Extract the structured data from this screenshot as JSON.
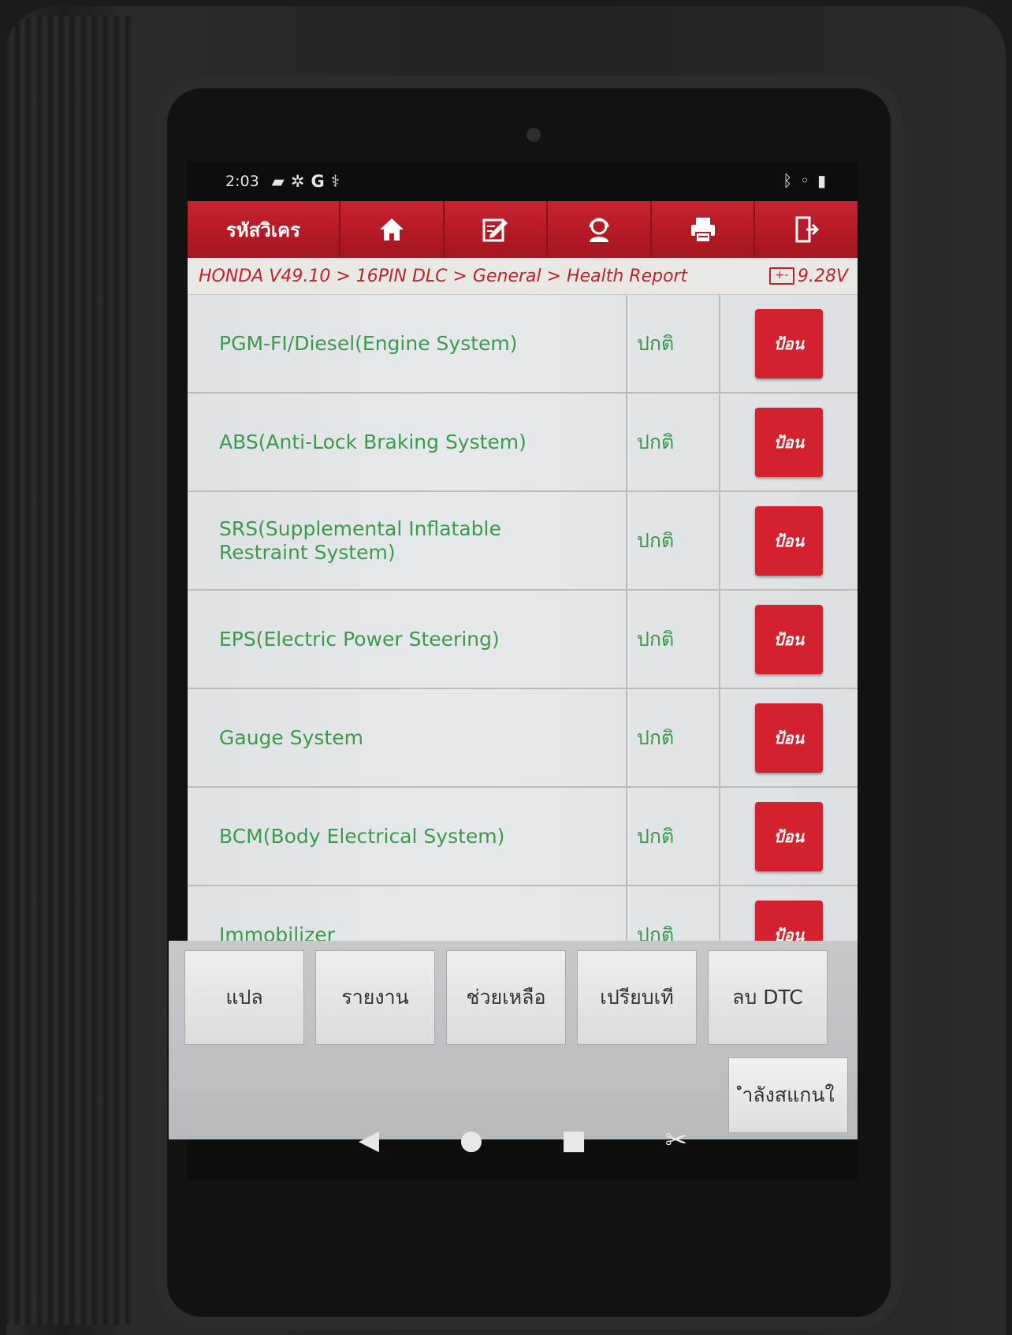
{
  "status_bar": {
    "time": "2:03",
    "left_icons": [
      "message-icon",
      "accessibility-icon",
      "google-icon",
      "diagnostic-icon"
    ],
    "right_icons": [
      "bluetooth-icon",
      "wifi-icon",
      "battery-icon"
    ]
  },
  "toolbar": {
    "title": "รหัสวิเคร",
    "buttons": [
      "home-icon",
      "edit-icon",
      "support-icon",
      "print-icon",
      "exit-icon"
    ]
  },
  "breadcrumb": {
    "path": "HONDA V49.10 > 16PIN DLC > General > Health Report",
    "voltage": "9.28V",
    "battery_symbol": "+-"
  },
  "systems": [
    {
      "name": "PGM-FI/Diesel(Engine System)",
      "status": "ปกติ",
      "action": "ป้อน"
    },
    {
      "name": "ABS(Anti-Lock Braking System)",
      "status": "ปกติ",
      "action": "ป้อน"
    },
    {
      "name": "SRS(Supplemental Inflatable Restraint System)",
      "status": "ปกติ",
      "action": "ป้อน"
    },
    {
      "name": "EPS(Electric Power Steering)",
      "status": "ปกติ",
      "action": "ป้อน"
    },
    {
      "name": "Gauge System",
      "status": "ปกติ",
      "action": "ป้อน"
    },
    {
      "name": "BCM(Body Electrical System)",
      "status": "ปกติ",
      "action": "ป้อน"
    },
    {
      "name": "Immobilizer",
      "status": "ปกติ",
      "action": "ป้อน"
    }
  ],
  "bottom_buttons": [
    "แปล",
    "รายงาน",
    "ช่วยเหลือ",
    "เปรียบเที",
    "ลบ DTC"
  ],
  "scan_button": "ำลังสแกนใ",
  "nav_bar": {
    "back": "◀",
    "home": "●",
    "recent": "■",
    "screenshot": "✂"
  },
  "colors": {
    "toolbar": "#b81b27",
    "text_ok": "#3c9a4a",
    "enter_button": "#d3222e",
    "breadcrumb": "#c3202c"
  }
}
